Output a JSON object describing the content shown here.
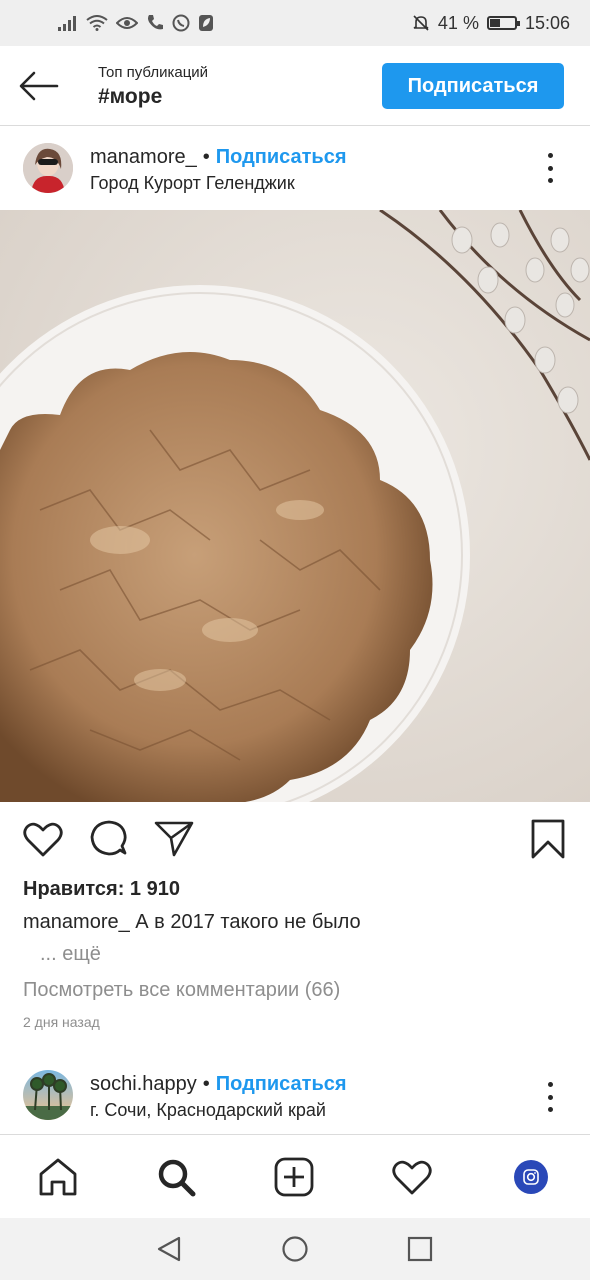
{
  "status_bar": {
    "battery_percent": "41 %",
    "battery_level": 0.41,
    "time": "15:06"
  },
  "header": {
    "subtitle": "Топ публикаций",
    "title": "#море",
    "follow_label": "Подписаться"
  },
  "post": {
    "username": "manamore_",
    "separator": "•",
    "follow_label": "Подписаться",
    "location": "Город Курорт Геленджик",
    "likes": "Нравится: 1 910",
    "caption_user": "manamore_",
    "caption_text": "А в 2017 такого не было",
    "more": "... ещё",
    "view_comments": "Посмотреть все комментарии (66)",
    "time_ago": "2 дня назад"
  },
  "next_post": {
    "username": "sochi.happy",
    "separator": "•",
    "follow_label": "Подписаться",
    "location": "г. Сочи, Краснодарский край"
  },
  "icons": {
    "back": "arrow-left-icon",
    "more": "more-vertical-icon",
    "like": "heart-icon",
    "comment": "comment-icon",
    "share": "send-icon",
    "save": "bookmark-icon",
    "home": "home-icon",
    "search": "search-icon",
    "new_post": "plus-square-icon",
    "activity": "heart-icon",
    "profile": "profile-avatar",
    "sys_back": "triangle-back-icon",
    "sys_home": "circle-home-icon",
    "sys_recent": "square-recent-icon"
  },
  "colors": {
    "accent": "#1e98ee",
    "text": "#262626",
    "secondary_text": "#8e8e8e"
  }
}
